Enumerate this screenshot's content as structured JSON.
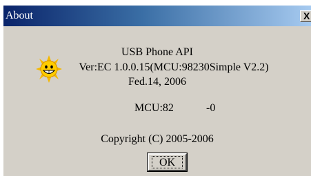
{
  "dialog": {
    "title": "About",
    "close_glyph": "X",
    "icon": "smiley-sun-icon",
    "product": "USB Phone API",
    "version": "Ver:EC 1.0.0.15(MCU:98230Simple V2.2)",
    "date": "Fed.14, 2006",
    "mcu_label": "MCU:82",
    "mcu_value": "-0",
    "copyright": "Copyright (C) 2005-2006",
    "ok_label": "OK"
  },
  "colors": {
    "title_start": "#0a246a",
    "title_end": "#a6caf0",
    "face": "#d4d0c8"
  }
}
